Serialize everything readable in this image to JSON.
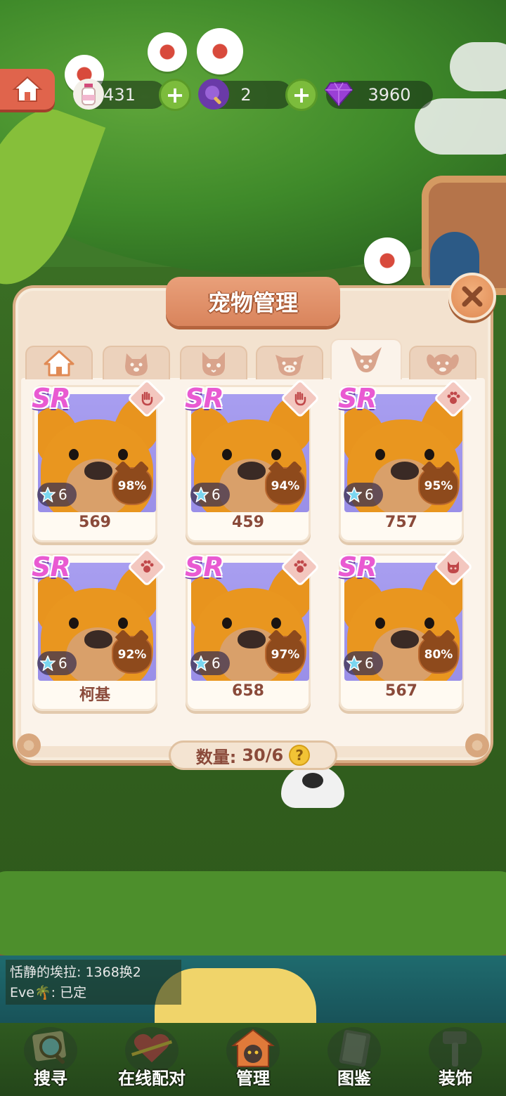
{
  "resources": {
    "milk": {
      "icon": "milk-bottle-icon",
      "value": "431"
    },
    "brush": {
      "icon": "brush-icon",
      "value": "2"
    },
    "gems": {
      "icon": "gem-icon",
      "value": "3960"
    }
  },
  "dialog": {
    "title": "宠物管理",
    "tabs": [
      {
        "icon": "house-icon",
        "active": false
      },
      {
        "icon": "dog-face-icon",
        "active": false
      },
      {
        "icon": "cat-face-icon",
        "active": false
      },
      {
        "icon": "pig-face-icon",
        "active": false
      },
      {
        "icon": "corgi-face-icon",
        "active": true
      },
      {
        "icon": "puppy-face-icon",
        "active": false
      }
    ],
    "pets": [
      {
        "rarity": "SR",
        "type_icon": "hand-icon",
        "stars": "6",
        "percent": "98%",
        "label": "569"
      },
      {
        "rarity": "SR",
        "type_icon": "hand-icon",
        "stars": "6",
        "percent": "94%",
        "label": "459"
      },
      {
        "rarity": "SR",
        "type_icon": "paw-icon",
        "stars": "6",
        "percent": "95%",
        "label": "757"
      },
      {
        "rarity": "SR",
        "type_icon": "paw-icon",
        "stars": "6",
        "percent": "92%",
        "label": "柯基"
      },
      {
        "rarity": "SR",
        "type_icon": "paw-icon",
        "stars": "6",
        "percent": "97%",
        "label": "658"
      },
      {
        "rarity": "SR",
        "type_icon": "cat-icon",
        "stars": "6",
        "percent": "80%",
        "label": "567"
      }
    ],
    "count_label": "数量:",
    "count_value": "30/6",
    "help": "?"
  },
  "chat": {
    "line1": "恬静的埃拉: 1368换2",
    "line2_name": "Eve",
    "line2_text": ": 已定"
  },
  "nav": [
    {
      "icon": "magnifier-icon",
      "label": "搜寻"
    },
    {
      "icon": "heart-arrow-icon",
      "label": "在线配对"
    },
    {
      "icon": "cat-house-icon",
      "label": "管理"
    },
    {
      "icon": "book-icon",
      "label": "图鉴"
    },
    {
      "icon": "hammer-icon",
      "label": "装饰"
    }
  ]
}
